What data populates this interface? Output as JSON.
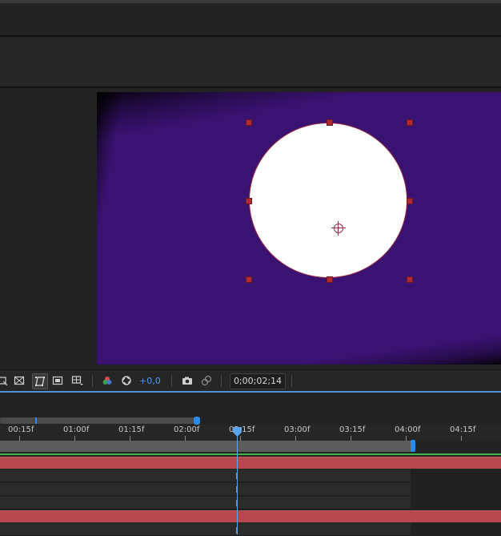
{
  "viewer": {
    "exposure_value": "+0,0",
    "timecode": "0;00;02;14"
  },
  "toolbar_icons": [
    "region-of-interest-icon",
    "transparency-grid-icon",
    "mask-path-visibility-icon",
    "safe-margins-icon",
    "grid-guides-icon",
    "channel-icon",
    "reset-exposure-icon",
    "snapshot-icon",
    "show-snapshot-icon"
  ],
  "timeline": {
    "ruler_labels": [
      "00:15f",
      "01:00f",
      "01:15f",
      "02:00f",
      "02:15f",
      "03:00f",
      "03:15f",
      "04:00f",
      "04:15f"
    ]
  },
  "colors": {
    "comp_background": "#3a1272",
    "layer_bar": "#b6474e",
    "accent_blue": "#2d8ceb",
    "handle_red": "#b22a30"
  }
}
